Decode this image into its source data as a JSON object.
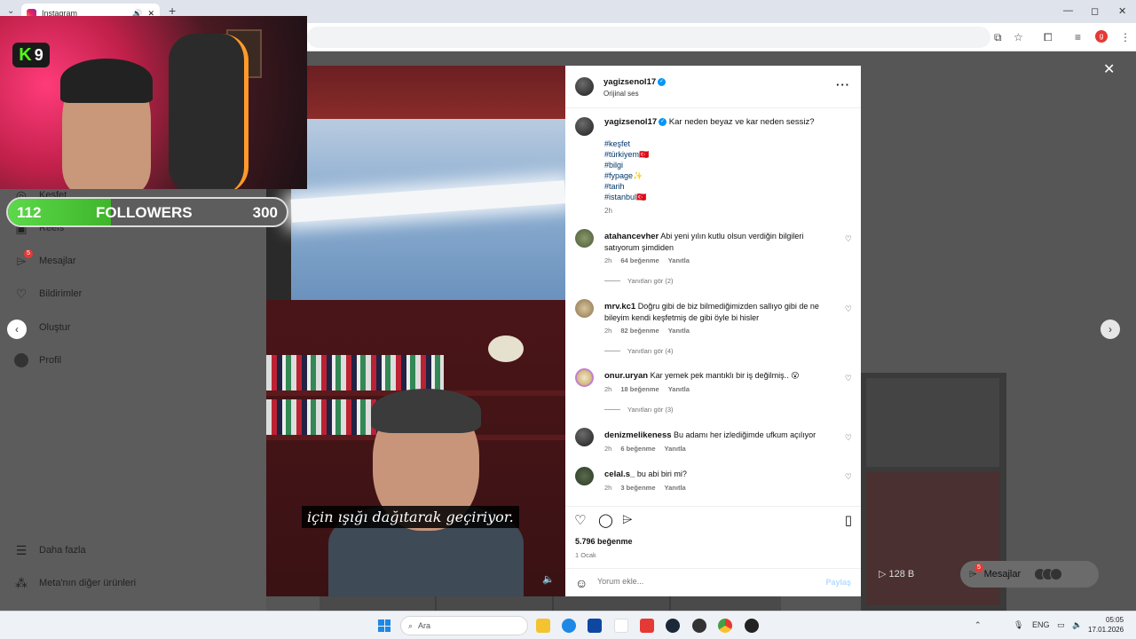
{
  "browser": {
    "tab_title": "Instagram",
    "tab_close": "✕",
    "new_tab": "+",
    "minimize": "—",
    "maximize": "◻",
    "close": "✕",
    "profile_initial": "g"
  },
  "sidebar": {
    "items": [
      {
        "label": "Keşfet",
        "icon": "compass-icon"
      },
      {
        "label": "Reels",
        "icon": "reels-icon"
      },
      {
        "label": "Mesajlar",
        "icon": "messages-icon",
        "badge": "5"
      },
      {
        "label": "Bildirimler",
        "icon": "heart-icon"
      },
      {
        "label": "Oluştur",
        "icon": "plus-icon"
      },
      {
        "label": "Profil",
        "icon": "profile-avatar"
      }
    ],
    "more": "Daha fazla",
    "meta": "Meta'nın diğer ürünleri"
  },
  "stream_overlay": {
    "kick_logo": "K",
    "viewer_count": "9",
    "followers_current": "112",
    "followers_label": "FOLLOWERS",
    "followers_goal": "300",
    "progress": 0.37
  },
  "video": {
    "subtitle": "için ışığı dağıtarak geçiriyor."
  },
  "post": {
    "username": "yagizsenol17",
    "audio": "Orijinal ses",
    "caption": "Kar neden beyaz ve kar neden sessiz?",
    "tags": [
      "#keşfet",
      "#türkiyem🇹🇷",
      "#bilgi",
      "#fypage✨",
      "#tarih",
      "#istanbul🇹🇷"
    ],
    "caption_time": "2h",
    "comments": [
      {
        "user": "atahancevher",
        "text": "Abi yeni yılın kutlu olsun verdiğin bilgileri satıyorum şimdiden",
        "time": "2h",
        "likes": "64 beğenme",
        "reply": "Yanıtla",
        "replies": "Yanıtları gör (2)"
      },
      {
        "user": "mrv.kc1",
        "text": "Doğru gibi de biz bilmediğimizden sallıyo gibi de ne bileyim kendi keşfetmiş de gibi öyle bi hisler",
        "time": "2h",
        "likes": "82 beğenme",
        "reply": "Yanıtla",
        "replies": "Yanıtları gör (4)"
      },
      {
        "user": "onur.uryan",
        "text": "Kar yemek pek mantıklı bir iş değilmiş.. 😮",
        "time": "2h",
        "likes": "18 beğenme",
        "reply": "Yanıtla",
        "replies": "Yanıtları gör (3)"
      },
      {
        "user": "denizmelikeness",
        "text": "Bu adamı her izlediğimde ufkum açılıyor",
        "time": "2h",
        "likes": "6 beğenme",
        "reply": "Yanıtla",
        "replies": ""
      },
      {
        "user": "celal.s_",
        "text": "bu abi biri mi?",
        "time": "2h",
        "likes": "3 beğenme",
        "reply": "Yanıtla",
        "replies": ""
      }
    ],
    "likes_total": "5.796 beğenme",
    "date": "1 Ocak",
    "comment_placeholder": "Yorum ekle...",
    "share_label": "Paylaş"
  },
  "background": {
    "views": "128 B",
    "messages_label": "Mesajlar",
    "messages_badge": "5"
  },
  "taskbar": {
    "search_label": "Ara",
    "lang": "ENG",
    "time": "05:05",
    "date": "17.01.2026"
  },
  "colors": {
    "accent_green": "#53fc18",
    "ig_blue": "#0095f6",
    "badge_red": "#e53935"
  }
}
